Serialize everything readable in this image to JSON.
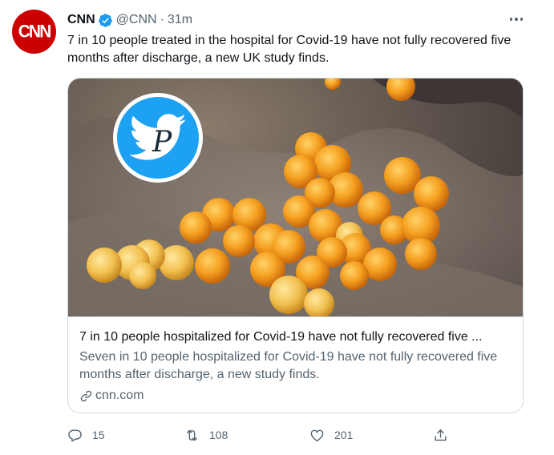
{
  "tweet": {
    "author": {
      "avatar_text": "CNN",
      "name": "CNN",
      "handle": "@CNN",
      "separator": "·",
      "time": "31m",
      "verified": true
    },
    "text": "7 in 10 people treated in the hospital for Covid-19 have not fully recovered five months after discharge, a new UK study finds.",
    "card": {
      "title": "7 in 10 people hospitalized for Covid-19 have not fully recovered five ...",
      "description": "Seven in 10 people hospitalized for Covid-19 have not fully recovered five months after discharge, a new study finds.",
      "domain": "cnn.com"
    },
    "actions": {
      "reply_count": "15",
      "retweet_count": "108",
      "like_count": "201"
    }
  },
  "icons": {
    "more": "more-icon",
    "verified": "verified-badge-icon",
    "link": "link-icon",
    "reply": "reply-icon",
    "retweet": "retweet-icon",
    "like": "like-icon",
    "share": "share-icon"
  },
  "colors": {
    "brand_red": "#cc0000",
    "verified_blue": "#1d9bf0",
    "text_primary": "#0f1419",
    "text_secondary": "#536471",
    "border": "#cfd9de"
  }
}
